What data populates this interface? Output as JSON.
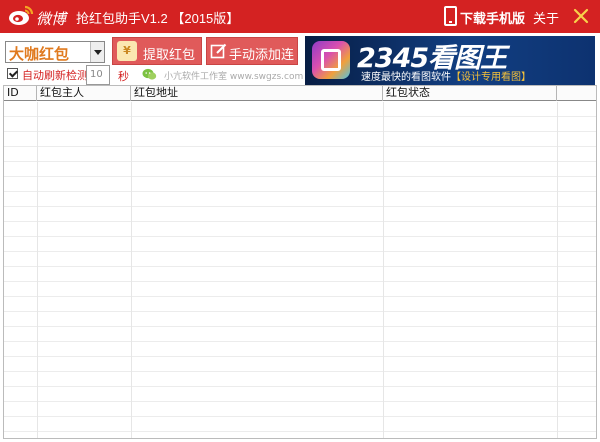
{
  "titlebar": {
    "logo_text": "微博",
    "title": "抢红包助手V1.2 【2015版】",
    "download_label": "下载手机版",
    "about_label": "关于"
  },
  "toolbar": {
    "packet_type_value": "大咖红包",
    "extract_label": "提取红包",
    "coin_glyph": "¥",
    "manual_add_label": "手动添加连接",
    "auto_refresh_label": "自动刷新检测",
    "auto_refresh_checked": true,
    "interval_value": "10",
    "seconds_label": "秒",
    "studio_label": "小亢软件工作室 www.swgzs.com"
  },
  "banner": {
    "title": "2345看图王",
    "subtitle": "速度最快的看图软件",
    "tag": "【设计专用看图】"
  },
  "table": {
    "columns": [
      "ID",
      "红包主人",
      "红包地址",
      "红包状态"
    ],
    "rows": []
  },
  "colors": {
    "titlebar": "#d42222",
    "button": "#e05a5a",
    "banner": "#0d3270",
    "accent_orange": "#e07a1f"
  },
  "icons": [
    "weibo-logo-icon",
    "phone-icon",
    "close-icon",
    "coin-icon",
    "edit-icon",
    "chat-icon",
    "kantu-app-icon"
  ]
}
